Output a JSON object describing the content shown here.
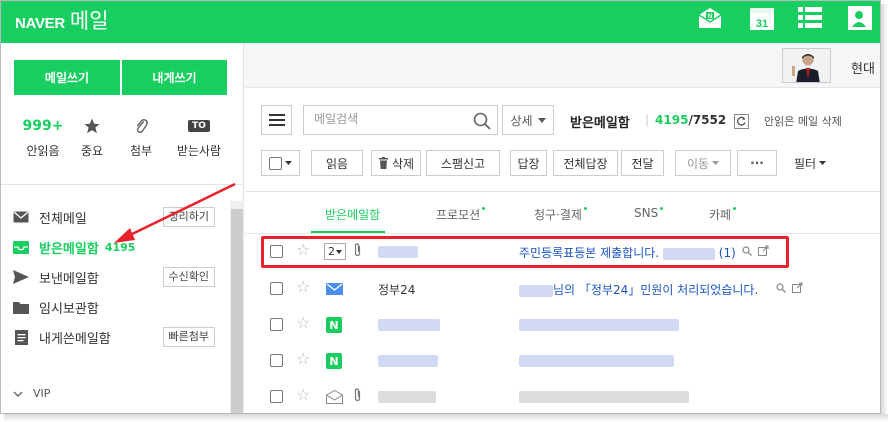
{
  "brand": {
    "naver": "NAVER",
    "mail": "메일"
  },
  "colors": {
    "accent": "#19ce60",
    "highlight": "#e8222a",
    "link": "#1a54c4"
  },
  "topbar_icons": [
    "mail-n-icon",
    "calendar-icon",
    "list-icon",
    "contacts-icon"
  ],
  "calendar_day": "31",
  "sidebar": {
    "write_mail": "메일쓰기",
    "write_to_me": "내게쓰기",
    "quick": [
      {
        "value": "999+",
        "label": "안읽음"
      },
      {
        "icon": "star-icon",
        "label": "중요"
      },
      {
        "icon": "paperclip-icon",
        "label": "첨부"
      },
      {
        "badge": "TO",
        "label": "받는사람"
      }
    ],
    "folders": [
      {
        "name": "전체메일",
        "icon": "envelope-icon",
        "action": "정리하기"
      },
      {
        "name": "받은메일함",
        "icon": "inbox-icon",
        "count": "4195"
      },
      {
        "name": "보낸메일함",
        "icon": "send-icon",
        "action": "수신확인"
      },
      {
        "name": "임시보관함",
        "icon": "folder-icon"
      },
      {
        "name": "내게쓴메일함",
        "icon": "note-icon",
        "action": "빠른첨부"
      }
    ],
    "vip": "VIP"
  },
  "header": {
    "user": "현대"
  },
  "search": {
    "placeholder": "메일검색",
    "detail": "상세"
  },
  "mailbox": {
    "title": "받은메일함",
    "unread": "4195",
    "total": "/7552",
    "delete_read": "안읽은 메일 삭제"
  },
  "toolbar": {
    "read": "읽음",
    "delete": "삭제",
    "spam": "스팸신고",
    "reply": "답장",
    "reply_all": "전체답장",
    "forward": "전달",
    "move": "이동",
    "more": "···",
    "filter": "필터"
  },
  "tabs": [
    {
      "label": "받은메일함",
      "dot": false
    },
    {
      "label": "프로모션",
      "dot": true
    },
    {
      "label": "청구·결제",
      "dot": true
    },
    {
      "label": "SNS",
      "dot": true
    },
    {
      "label": "카페",
      "dot": true
    }
  ],
  "mails": [
    {
      "count": "2",
      "subject": "주민등록표등본 제출합니다.",
      "tail_count": "(1)"
    },
    {
      "sender": "정부24",
      "subject_suffix": "님의 「정부24」민원이 처리되었습니다."
    }
  ]
}
